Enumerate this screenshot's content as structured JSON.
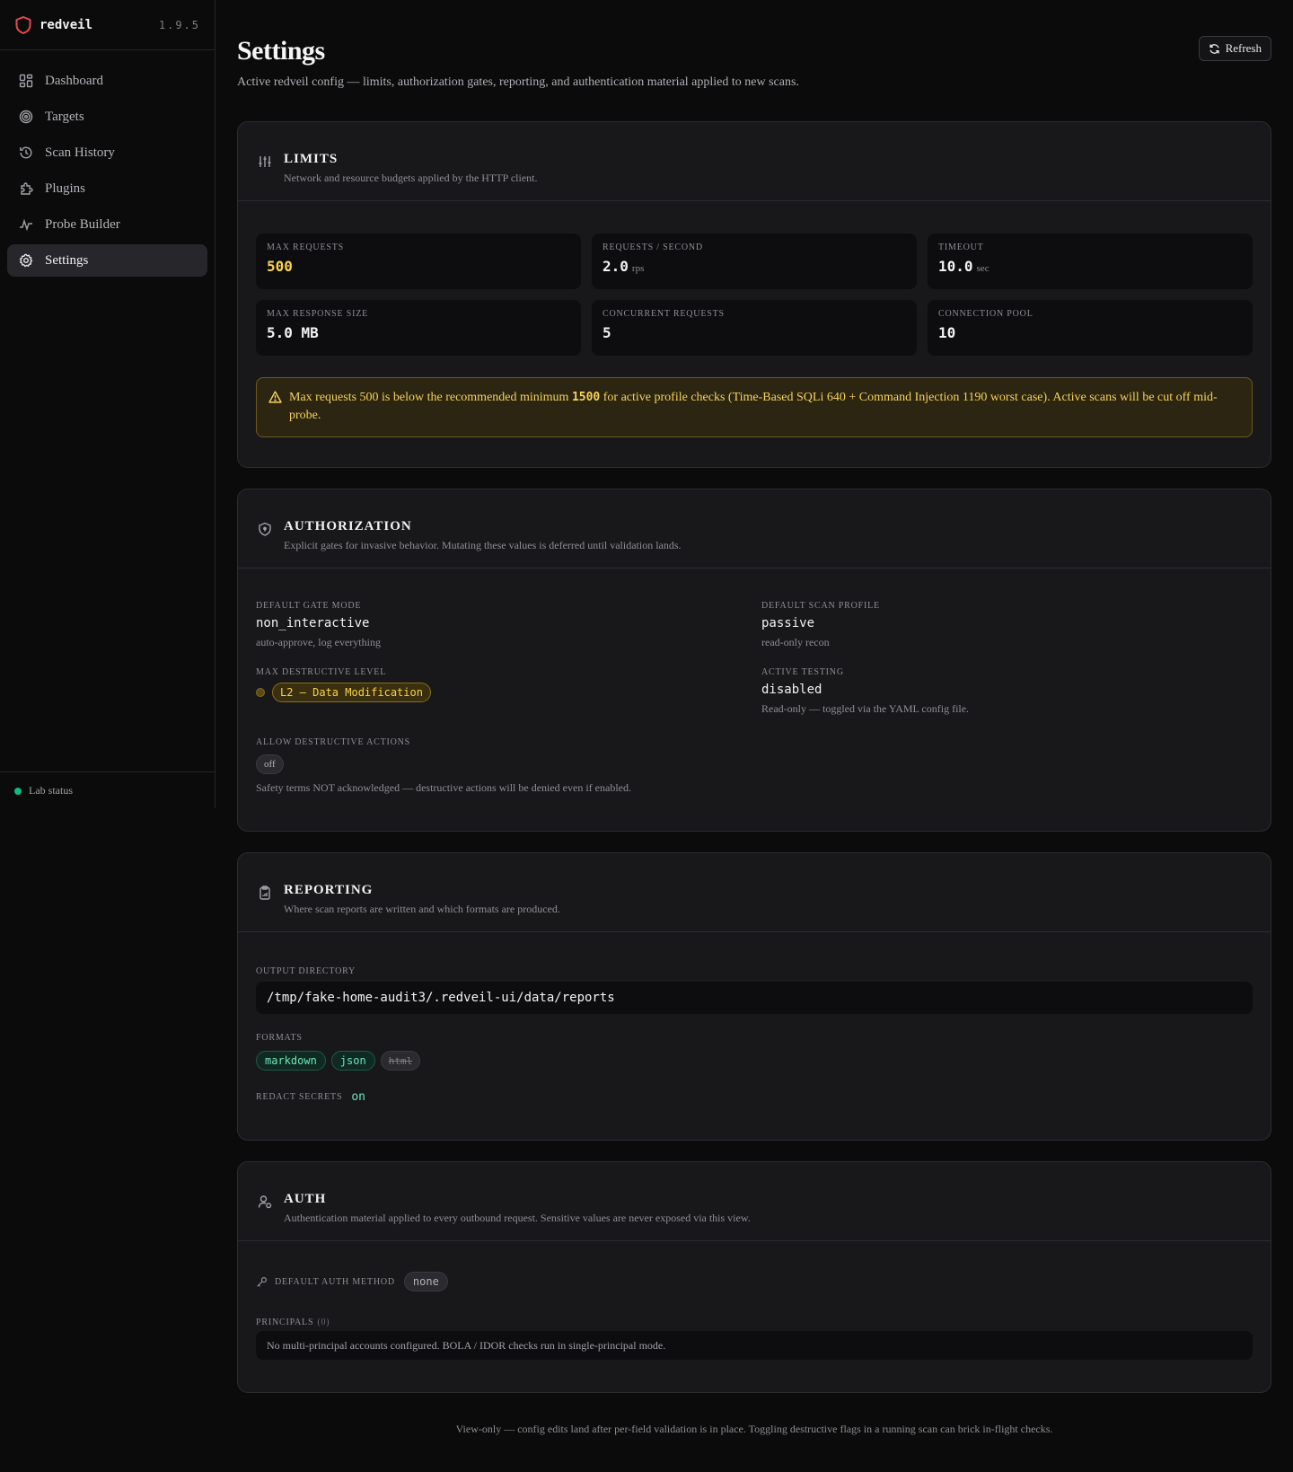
{
  "brand": {
    "name": "redveil",
    "version": "1.9.5"
  },
  "sidebar": {
    "items": [
      {
        "label": "Dashboard",
        "icon": "dashboard-icon"
      },
      {
        "label": "Targets",
        "icon": "target-icon"
      },
      {
        "label": "Scan History",
        "icon": "history-icon"
      },
      {
        "label": "Plugins",
        "icon": "puzzle-icon"
      },
      {
        "label": "Probe Builder",
        "icon": "pulse-icon"
      },
      {
        "label": "Settings",
        "icon": "gear-icon",
        "active": true
      }
    ],
    "lab_status": "Lab status"
  },
  "header": {
    "title": "Settings",
    "subtitle": "Active redveil config — limits, authorization gates, reporting, and authentication material applied to new scans.",
    "refresh_label": "Refresh"
  },
  "limits": {
    "title": "LIMITS",
    "description": "Network and resource budgets applied by the HTTP client.",
    "stats": [
      {
        "label": "MAX REQUESTS",
        "value": "500",
        "unit": ""
      },
      {
        "label": "REQUESTS / SECOND",
        "value": "2.0",
        "unit": "rps"
      },
      {
        "label": "TIMEOUT",
        "value": "10.0",
        "unit": "sec"
      },
      {
        "label": "MAX RESPONSE SIZE",
        "value": "5.0 MB",
        "unit": ""
      },
      {
        "label": "CONCURRENT REQUESTS",
        "value": "5",
        "unit": ""
      },
      {
        "label": "CONNECTION POOL",
        "value": "10",
        "unit": ""
      }
    ],
    "warning": {
      "pre": "Max requests 500 is below the recommended minimum ",
      "number": "1500",
      "post": " for active profile checks (Time-Based SQLi 640 + Command Injection 1190 worst case). Active scans will be cut off mid-probe."
    }
  },
  "authorization": {
    "title": "AUTHORIZATION",
    "description": "Explicit gates for invasive behavior. Mutating these values is deferred until validation lands.",
    "gate_mode": {
      "label": "DEFAULT GATE MODE",
      "value": "non_interactive",
      "hint": "auto-approve, log everything"
    },
    "scan_profile": {
      "label": "DEFAULT SCAN PROFILE",
      "value": "passive",
      "hint": "read-only recon"
    },
    "destructive_level": {
      "label": "MAX DESTRUCTIVE LEVEL",
      "value": "L2 — Data Modification"
    },
    "active_testing": {
      "label": "ACTIVE TESTING",
      "value": "disabled",
      "hint": "Read-only — toggled via the YAML config file."
    },
    "allow_destructive": {
      "label": "ALLOW DESTRUCTIVE ACTIONS",
      "value": "off",
      "hint": "Safety terms NOT acknowledged — destructive actions will be denied even if enabled."
    }
  },
  "reporting": {
    "title": "REPORTING",
    "description": "Where scan reports are written and which formats are produced.",
    "output_label": "OUTPUT DIRECTORY",
    "output_dir": "/tmp/fake-home-audit3/.redveil-ui/data/reports",
    "formats_label": "FORMATS",
    "formats": [
      "markdown",
      "json",
      "html"
    ],
    "redact_label": "REDACT SECRETS",
    "redact_value": "on"
  },
  "auth": {
    "title": "AUTH",
    "description": "Authentication material applied to every outbound request. Sensitive values are never exposed via this view.",
    "method_label": "DEFAULT AUTH METHOD",
    "method_value": "none",
    "principals_label": "PRINCIPALS",
    "principals_count": "(0)",
    "principals_empty": "No multi-principal accounts configured. BOLA / IDOR checks run in single-principal mode."
  },
  "footer": "View-only — config edits land after per-field validation is in place. Toggling destructive flags in a running scan can brick in-flight checks.",
  "colors": {
    "accent_red": "#e5484d",
    "warning": "#fbd34b",
    "success": "#10b981",
    "background": "#0b0b0c",
    "card": "#18181b"
  }
}
